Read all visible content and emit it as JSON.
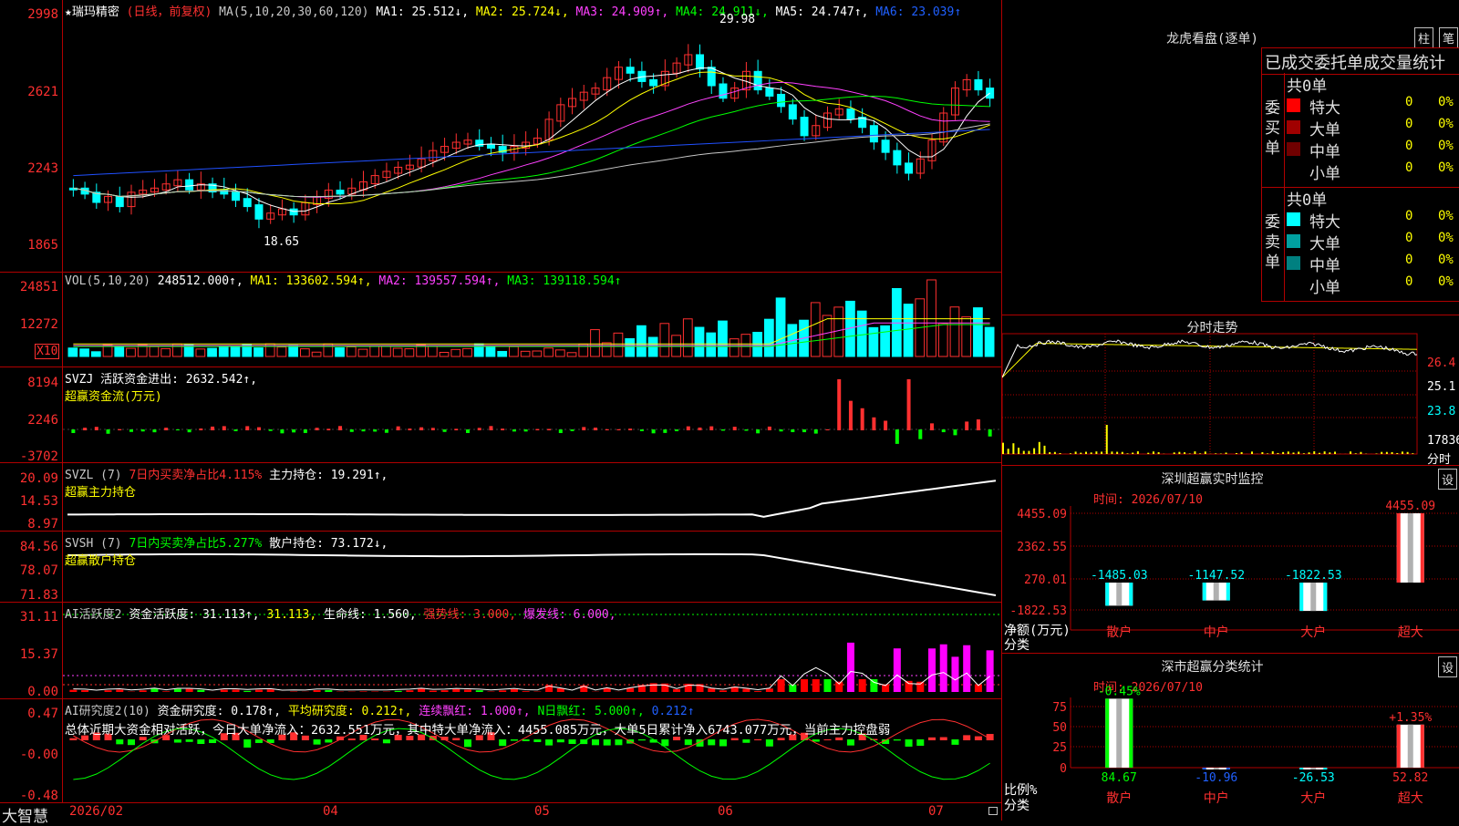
{
  "kline": {
    "title": "★瑞玛精密",
    "period": "(日线，前复权)",
    "ma_label": "MA(5,10,20,30,60,120)",
    "ma1": "MA1: 25.512↓,",
    "ma2": "MA2: 25.724↓,",
    "ma3": "MA3: 24.909↑,",
    "ma4": "MA4: 24.911↓,",
    "ma5": "MA5: 24.747↑,",
    "ma6": "MA6: 23.039↑",
    "high_label": "29.98",
    "low_label": "18.65",
    "y_ticks": [
      "2998",
      "2621",
      "2243",
      "1865"
    ]
  },
  "vol": {
    "header": "VOL(5,10,20)",
    "value": "248512.000↑,",
    "ma1": "MA1: 133602.594↑,",
    "ma2": "MA2: 139557.594↑,",
    "ma3": "MA3: 139118.594↑",
    "y_ticks": [
      "24851",
      "12272"
    ],
    "unit": "X10"
  },
  "svzj": {
    "header": "SVZJ  活跃资金进出: 2632.542↑,",
    "sub": "超赢资金流(万元)",
    "y_ticks": [
      "8194",
      "2246",
      "-3702"
    ]
  },
  "svzl": {
    "name": "SVZL (7)",
    "ratio": "7日内买卖净占比4.115%",
    "hold": "主力持仓: 19.291↑,",
    "sub": "超赢主力持仓",
    "y_ticks": [
      "20.09",
      "14.53",
      "8.97"
    ]
  },
  "svsh": {
    "name": "SVSH (7)",
    "ratio": "7日内买卖净占比5.277%",
    "hold": "散户持仓: 73.172↓,",
    "sub": "超赢散户持仓",
    "y_ticks": [
      "84.56",
      "78.07",
      "71.83"
    ]
  },
  "ai1": {
    "name": "AI活跃度2",
    "v1": "资金活跃度: 31.113↑,",
    "v2": "31.113,",
    "v3": "生命线: 1.560,",
    "v4": "强势线: 3.000,",
    "v5": "爆发线: 6.000,",
    "y_ticks": [
      "31.11",
      "15.37",
      "0.00"
    ]
  },
  "ai2": {
    "name": "AI研究度2(10)",
    "v1": "资金研究度: 0.178↑,",
    "v2": "平均研究度: 0.212↑,",
    "v3": "连续飘红: 1.000↑,",
    "v4": "N日飘红: 5.000↑,",
    "v5": "0.212↑",
    "summary": "总体近期大资金相对活跃，今日大单净流入：2632.551万元，其中特大单净流入：4455.085万元，大单5日累计净入6743.077万元，当前主力控盘弱",
    "y_ticks": [
      "0.47",
      "-0.00",
      "-0.48"
    ]
  },
  "xaxis": {
    "brand": "大智慧",
    "labels": [
      "2026/02",
      "04",
      "05",
      "06",
      "07"
    ]
  },
  "dragon": {
    "title": "龙虎看盘(逐单)",
    "btn1": "柱",
    "btn2": "笔",
    "header": "已成交委托单成交量统计",
    "buy": {
      "label": "委买单",
      "total": "共0单",
      "rows": [
        {
          "name": "特大",
          "count": "0",
          "pct": "0%",
          "color": "#ff0000"
        },
        {
          "name": "大单",
          "count": "0",
          "pct": "0%",
          "color": "#a00000"
        },
        {
          "name": "中单",
          "count": "0",
          "pct": "0%",
          "color": "#700000"
        },
        {
          "name": "小单",
          "count": "0",
          "pct": "0%",
          "color": ""
        }
      ]
    },
    "sell": {
      "label": "委卖单",
      "total": "共0单",
      "rows": [
        {
          "name": "特大",
          "count": "0",
          "pct": "0%",
          "color": "#00ffff"
        },
        {
          "name": "大单",
          "count": "0",
          "pct": "0%",
          "color": "#00a0a0"
        },
        {
          "name": "中单",
          "count": "0",
          "pct": "0%",
          "color": "#008080"
        },
        {
          "name": "小单",
          "count": "0",
          "pct": "0%",
          "color": ""
        }
      ]
    }
  },
  "intraday": {
    "title": "分时走势",
    "labels": [
      "26.4",
      "25.1",
      "23.8"
    ],
    "vol": "17836",
    "vol_unit": "分时"
  },
  "monitor": {
    "title": "深圳超赢实时监控",
    "btn": "设",
    "time": "时间: 2026/07/10",
    "y_ticks": [
      "4455.09",
      "2362.55",
      "270.01",
      "-1822.53"
    ],
    "bottom_left": [
      "净额(万元)",
      "分类"
    ],
    "chart_data": {
      "type": "bar",
      "categories": [
        "散户",
        "中户",
        "大户",
        "超大"
      ],
      "values": [
        -1485.03,
        -1147.52,
        -1822.53,
        4455.09
      ],
      "labels": [
        "-1485.03",
        "-1147.52",
        "-1822.53",
        "4455.09"
      ]
    }
  },
  "classstat": {
    "title": "深市超赢分类统计",
    "btn": "设",
    "time": "时间: 2026/07/10",
    "y_ticks": [
      "75",
      "50",
      "25",
      "0"
    ],
    "bottom_left": [
      "比例%",
      "分类"
    ],
    "chart_data": {
      "type": "bar",
      "categories": [
        "散户",
        "中户",
        "大户",
        "超大"
      ],
      "values": [
        84.67,
        -10.96,
        -26.53,
        52.82
      ],
      "labels": [
        "84.67",
        "-10.96",
        "-26.53",
        "52.82"
      ],
      "changes": [
        "-0.45%",
        "",
        "",
        "+1.35%"
      ]
    }
  }
}
